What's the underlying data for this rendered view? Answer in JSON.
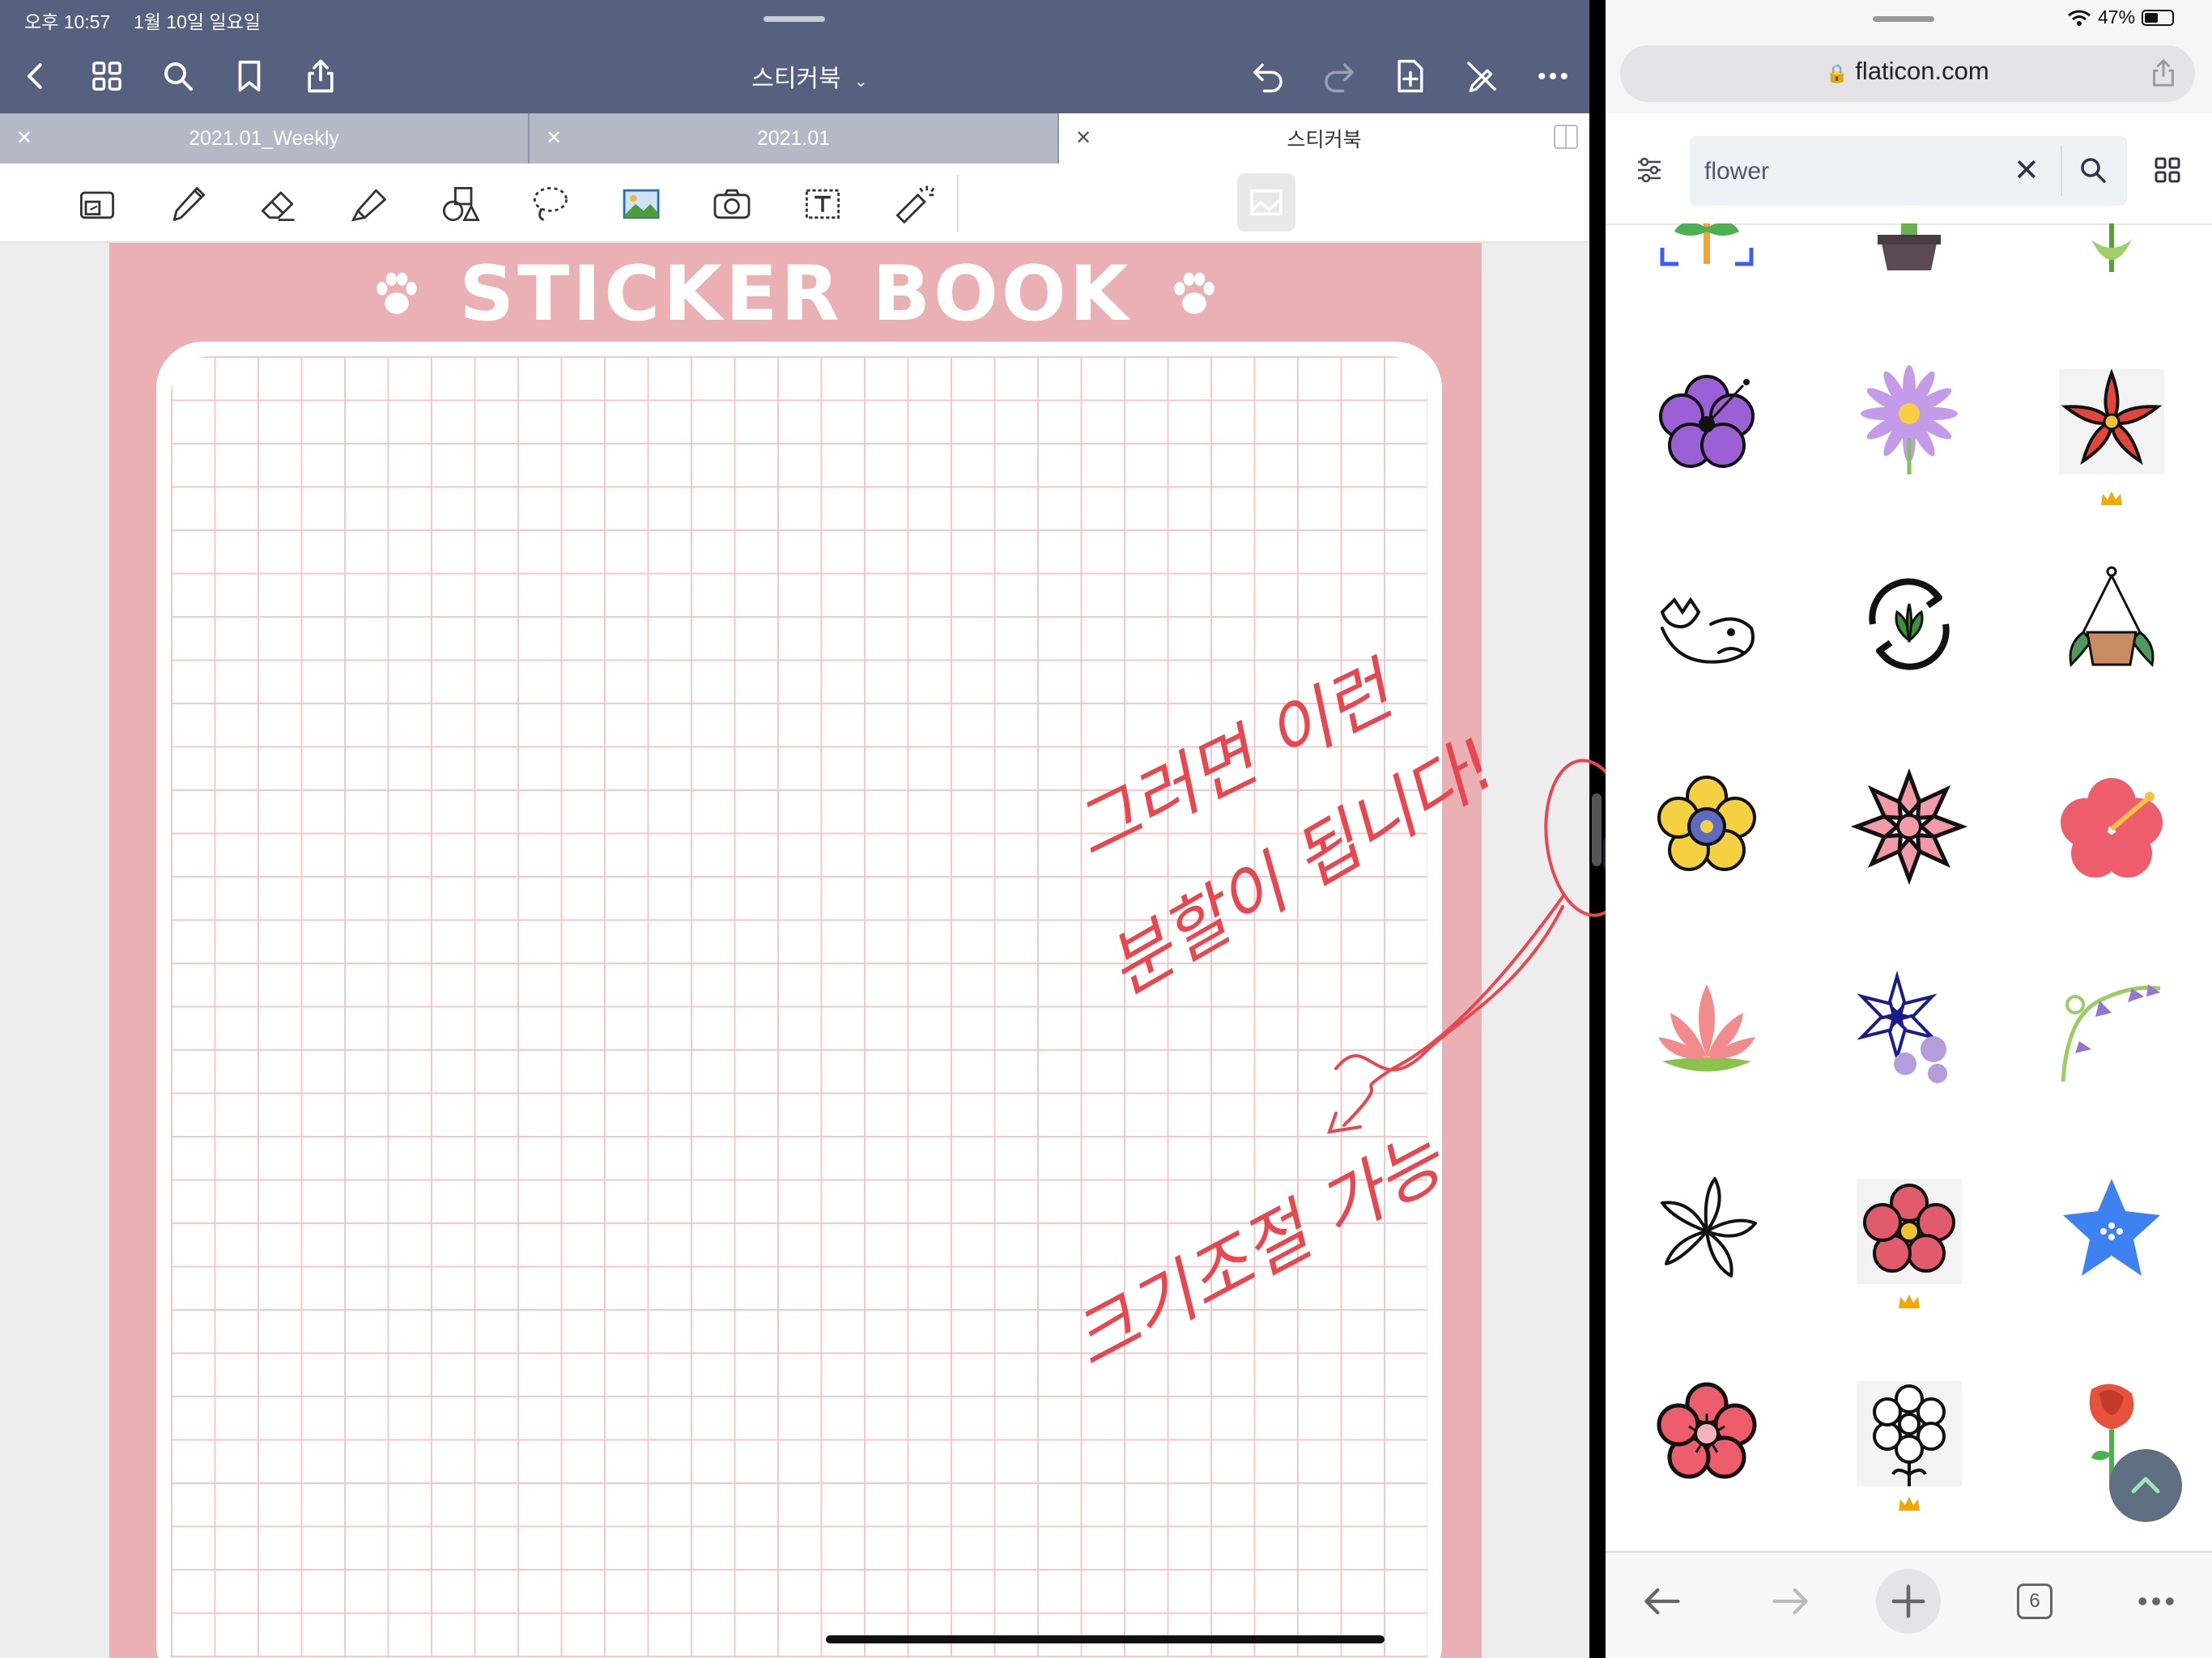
{
  "status_bar": {
    "time": "오후 10:57",
    "date": "1월 10일 일요일",
    "battery": "47%"
  },
  "notes_app": {
    "document_title": "스티커북",
    "tabs": [
      {
        "label": "2021.01_Weekly",
        "active": false
      },
      {
        "label": "2021.01",
        "active": false
      },
      {
        "label": "스티커북",
        "active": true
      }
    ],
    "page": {
      "title": "STICKER BOOK"
    },
    "handwriting": {
      "line1": "그러면 이런",
      "line2": "분할이 됩니다!",
      "line3": "크기조절 가능"
    },
    "colors": {
      "nav": "#56607f",
      "page_pink": "#eab0b4",
      "grid_line": "#f1c8cb",
      "ink": "#e8474f"
    }
  },
  "safari": {
    "url": "flaticon.com",
    "search_value": "flower",
    "tab_count": "6"
  }
}
